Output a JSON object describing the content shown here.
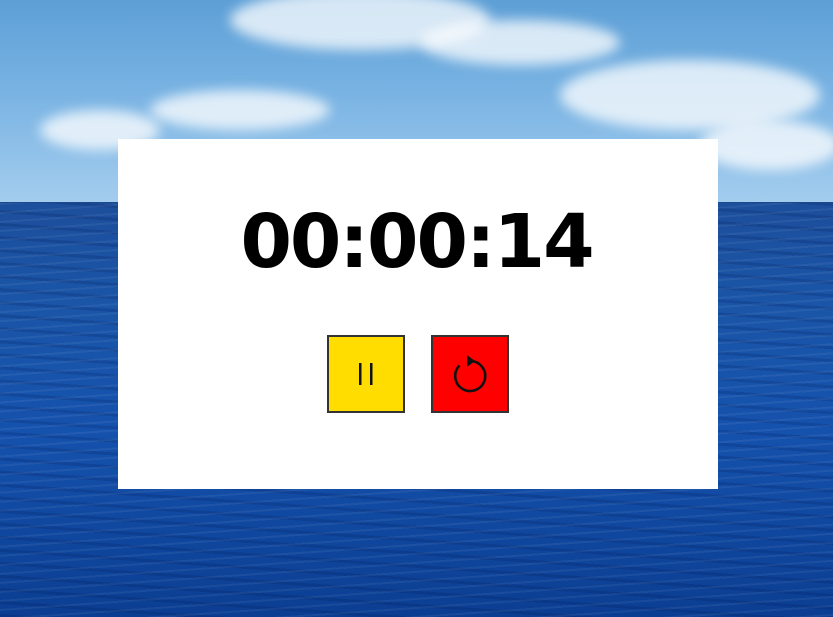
{
  "timer": {
    "display": "00:00:14"
  },
  "controls": {
    "pause": {
      "icon": "pause-icon",
      "color": "#ffdd00"
    },
    "reset": {
      "icon": "restart-icon",
      "color": "#ff0000"
    }
  },
  "theme": {
    "card_background": "#ffffff",
    "text_color": "#000000",
    "background": "ocean-sky-photo"
  }
}
